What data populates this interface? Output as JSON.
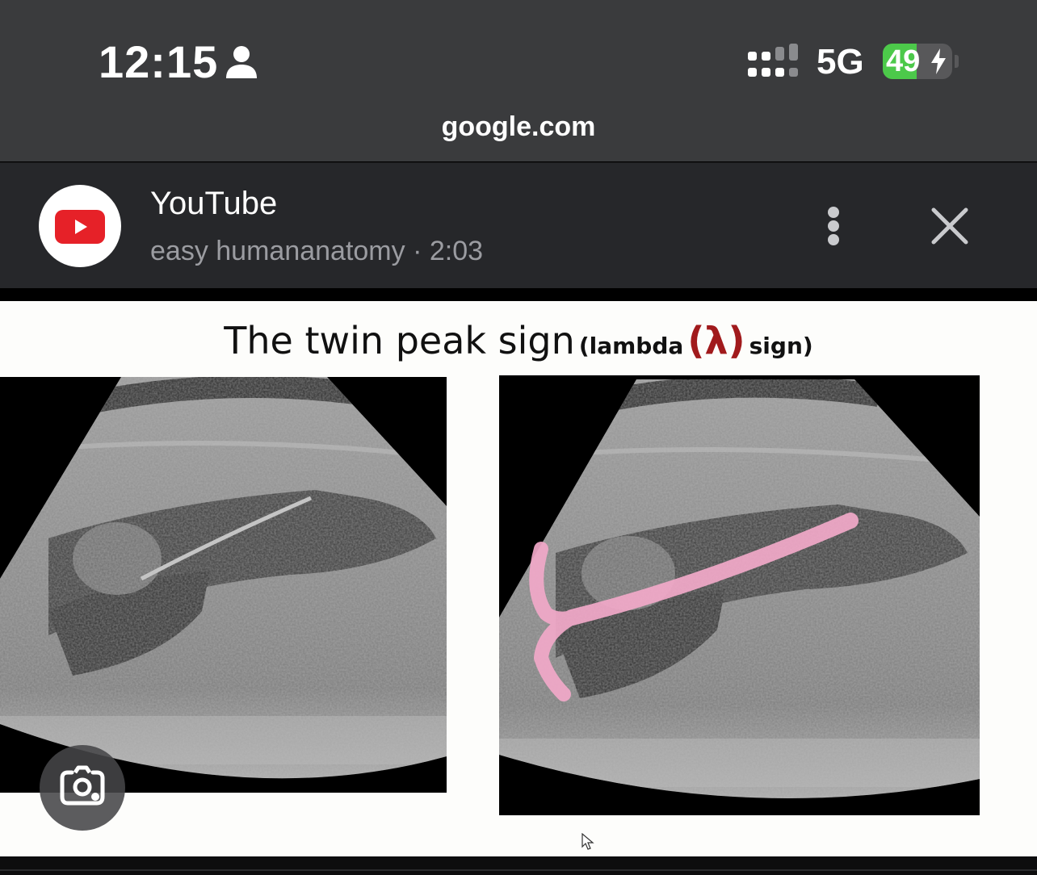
{
  "status_bar": {
    "time": "12:15",
    "network": "5G",
    "battery_level": "49",
    "battery_fraction": 0.49,
    "colors": {
      "battery": "#4cc94a",
      "background": "#3a3b3d"
    },
    "icons": [
      "person-icon",
      "signal-icon",
      "charging-icon"
    ]
  },
  "browser": {
    "url": "google.com"
  },
  "source": {
    "title": "YouTube",
    "subtitle": "easy humananatomy · 2:03",
    "icons": [
      "youtube-logo-icon",
      "more-vertical-icon",
      "close-icon"
    ],
    "colors": {
      "logo": "#e62128",
      "background": "#26272a"
    }
  },
  "slide": {
    "title_main": "The twin peak sign",
    "title_pre": "(lambda",
    "title_symbol": "(λ)",
    "title_post": "sign)",
    "colors": {
      "lambda": "#a11a1c",
      "annotation": "#f2a9c9"
    }
  },
  "overlay": {
    "icons": [
      "google-lens-icon",
      "cursor-icon"
    ]
  }
}
